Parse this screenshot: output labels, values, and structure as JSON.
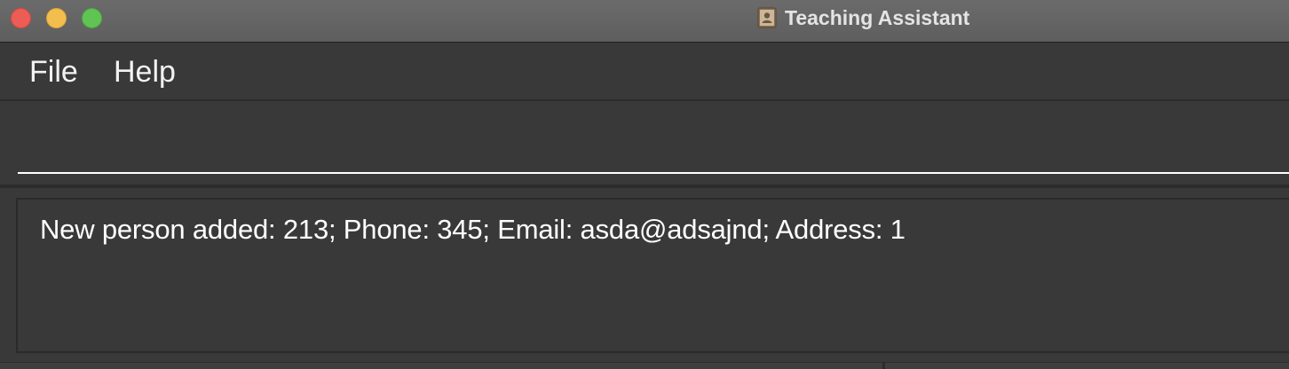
{
  "window": {
    "title": "Teaching Assistant"
  },
  "colors": {
    "titlebar": "#5f5f5f",
    "background": "#393939",
    "text": "#ffffff",
    "close": "#ee5d55",
    "minimize": "#f4be4f",
    "zoom": "#5fc453"
  },
  "menu": {
    "items": [
      {
        "label": "File"
      },
      {
        "label": "Help"
      }
    ]
  },
  "command": {
    "value": "",
    "placeholder": ""
  },
  "result": {
    "message": "New person added: 213; Phone: 345; Email: asda@adsajnd; Address: 1"
  }
}
